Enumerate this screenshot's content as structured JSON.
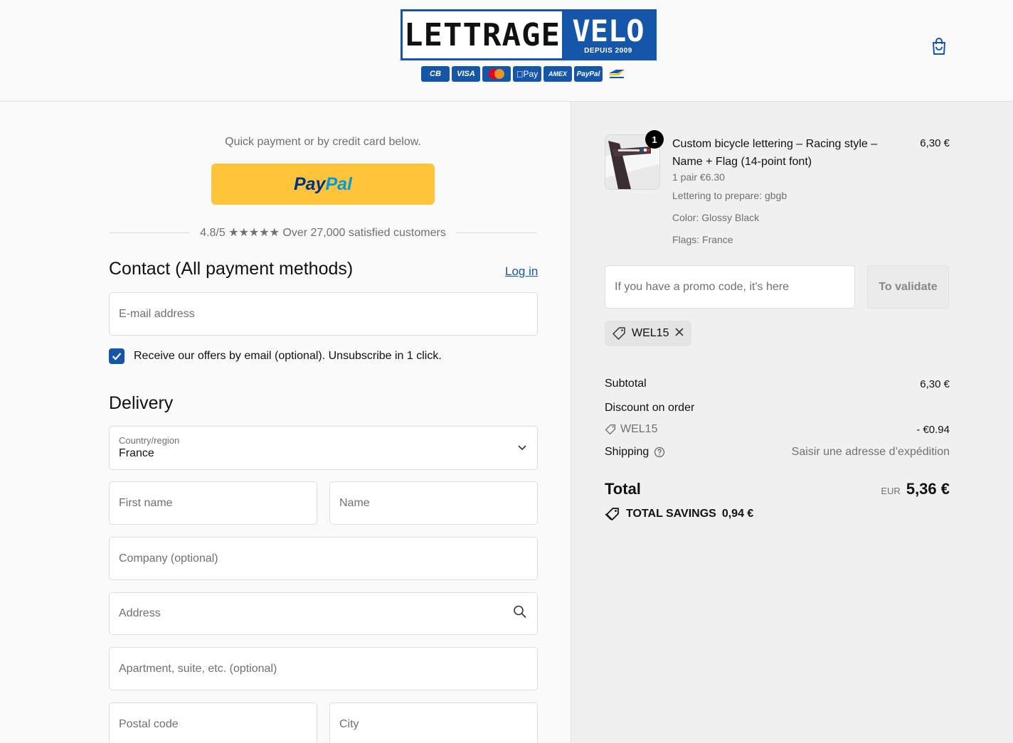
{
  "header": {
    "logo_left": "LETTRAGE",
    "logo_right": "VELO",
    "logo_sub": "DEPUIS 2009",
    "payment_icons": [
      "CB",
      "VISA",
      "Mastercard",
      "Pay",
      "AMEX",
      "PayPal",
      "Bancontact"
    ],
    "cart_icon": "shopping-bag-icon"
  },
  "express": {
    "intro": "Quick payment or by credit card below.",
    "paypal_a": "Pay",
    "paypal_b": "Pal",
    "rating": "4.8/5 ★★★★★ Over 27,000 satisfied customers"
  },
  "contact": {
    "title": "Contact (All payment methods)",
    "login": "Log in",
    "email_placeholder": "E-mail address",
    "newsletter": "Receive our offers by email (optional). Unsubscribe in 1 click.",
    "newsletter_checked": true
  },
  "delivery": {
    "title": "Delivery",
    "country_label": "Country/region",
    "country_value": "France",
    "first_name": "First name",
    "last_name": "Name",
    "company": "Company (optional)",
    "address": "Address",
    "apartment": "Apartment, suite, etc. (optional)",
    "postal": "Postal code",
    "city": "City"
  },
  "summary": {
    "item": {
      "qty": "1",
      "title": "Custom bicycle lettering – Racing style – Name + Flag (14-point font)",
      "price": "6,30 €",
      "unit": "1 pair €6.30",
      "lettering": "Lettering to prepare: gbgb",
      "color": "Color: Glossy Black",
      "flags": "Flags: France"
    },
    "promo_placeholder": "If you have a promo code, it's here",
    "promo_button": "To validate",
    "applied_code": "WEL15",
    "subtotal_label": "Subtotal",
    "subtotal_value": "6,30 €",
    "discount_label": "Discount on order",
    "discount_code": "WEL15",
    "discount_value": "- €0.94",
    "shipping_label": "Shipping",
    "shipping_value": "Saisir une adresse d’expédition",
    "total_label": "Total",
    "total_currency": "EUR",
    "total_value": "5,36 €",
    "savings_label": "TOTAL SAVINGS",
    "savings_value": "0,94 €"
  },
  "colors": {
    "brand_blue": "#1656a8",
    "paypal_yellow": "#ffc439"
  }
}
